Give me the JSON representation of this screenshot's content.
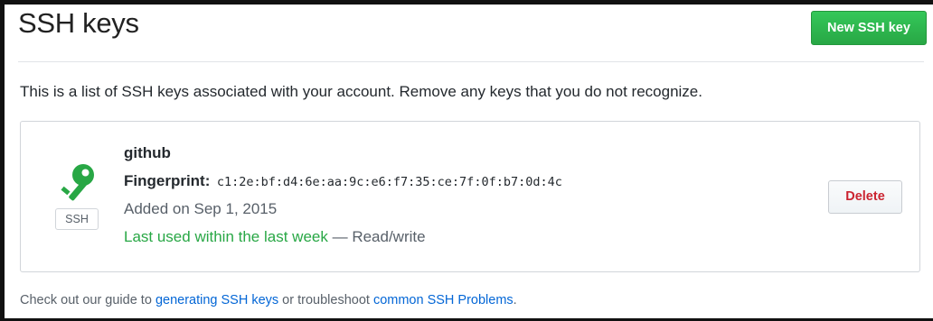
{
  "header": {
    "title": "SSH keys",
    "new_key_label": "New SSH key"
  },
  "intro": "This is a list of SSH keys associated with your account. Remove any keys that you do not recognize.",
  "keys": [
    {
      "type_badge": "SSH",
      "icon": "key-icon",
      "title": "github",
      "fingerprint_label": "Fingerprint:",
      "fingerprint": "c1:2e:bf:d4:6e:aa:9c:e6:f7:35:ce:7f:0f:b7:0d:4c",
      "added": "Added on Sep 1, 2015",
      "last_used": "Last used within the last week",
      "separator": " — ",
      "access": "Read/write",
      "delete_label": "Delete"
    }
  ],
  "footer": {
    "prefix": "Check out our guide to ",
    "link1": "generating SSH keys",
    "middle": " or troubleshoot ",
    "link2": "common SSH Problems",
    "suffix": "."
  },
  "colors": {
    "primary_button": "#28a745",
    "key_icon": "#28a745",
    "danger": "#cb2431",
    "link": "#0366d6",
    "last_used": "#28a745"
  }
}
